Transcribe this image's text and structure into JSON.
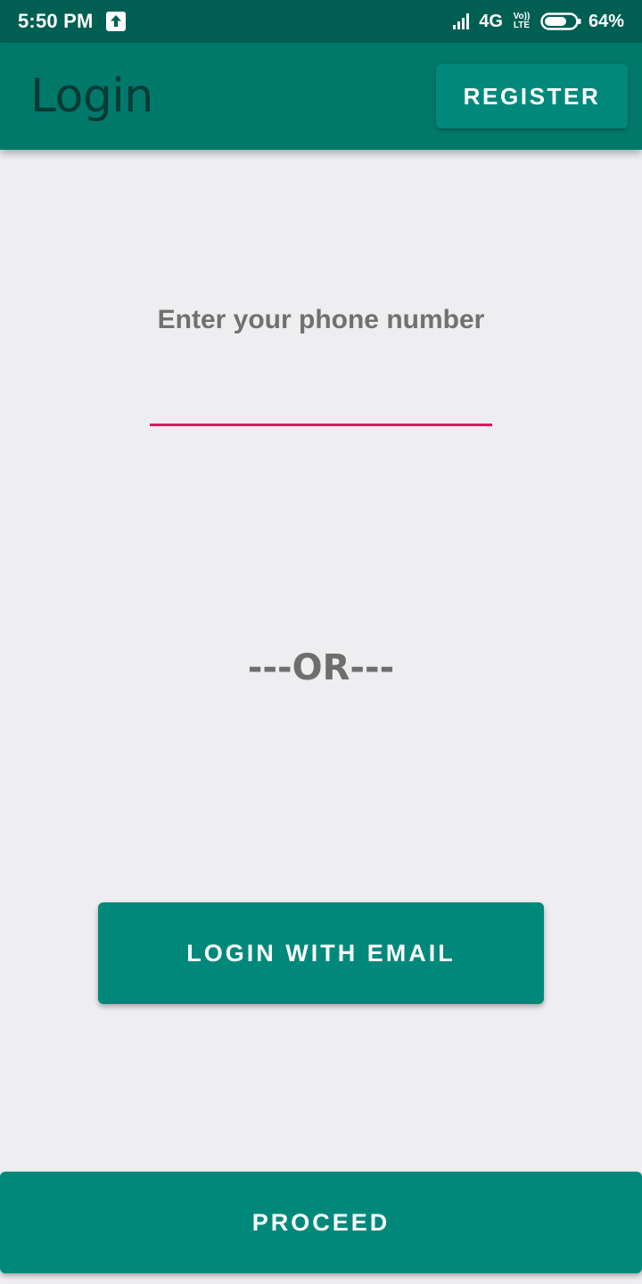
{
  "status_bar": {
    "time": "5:50 PM",
    "network": "4G",
    "volte_top": "Vo))",
    "volte_bottom": "LTE",
    "battery": "64%",
    "icons": [
      "upload-icon",
      "signal-icon",
      "volte-icon",
      "battery-icon"
    ]
  },
  "app_bar": {
    "title": "Login",
    "register_label": "REGISTER",
    "background": "#00796b"
  },
  "form": {
    "phone_label": "Enter your phone number",
    "phone_value": "",
    "phone_placeholder": "",
    "underline_color": "#d81b60"
  },
  "divider": {
    "text": "---OR---"
  },
  "actions": {
    "email_label": "LOGIN WITH EMAIL",
    "proceed_label": "PROCEED",
    "accent": "#00897b"
  }
}
